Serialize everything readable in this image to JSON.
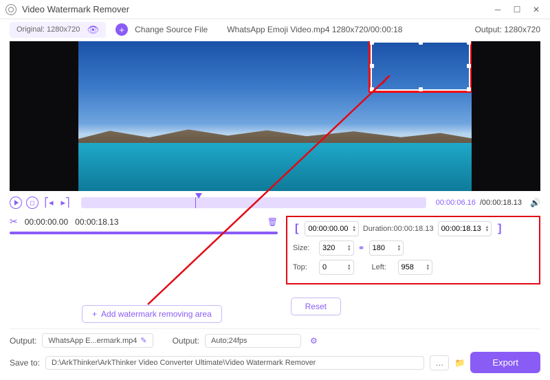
{
  "titlebar": {
    "title": "Video Watermark Remover"
  },
  "top": {
    "original_label": "Original: 1280x720",
    "change_source_label": "Change Source File",
    "file_info": "WhatsApp Emoji Video.mp4    1280x720/00:00:18",
    "output_res": "Output: 1280x720"
  },
  "playback": {
    "current": "00:00:06.16",
    "total": "/00:00:18.13"
  },
  "segment": {
    "start": "00:00:00.00",
    "end": "00:00:18.13"
  },
  "panel": {
    "range_start": "00:00:00.00",
    "duration_label": "Duration:00:00:18.13",
    "range_end": "00:00:18.13",
    "size_label": "Size:",
    "width": "320",
    "height": "180",
    "top_label": "Top:",
    "top": "0",
    "left_label": "Left:",
    "left": "958"
  },
  "buttons": {
    "add_area": "Add watermark removing area",
    "reset": "Reset",
    "export": "Export"
  },
  "output": {
    "label1": "Output:",
    "filename": "WhatsApp E...ermark.mp4",
    "label2": "Output:",
    "format": "Auto;24fps",
    "save_label": "Save to:",
    "save_path": "D:\\ArkThinker\\ArkThinker Video Converter Ultimate\\Video Watermark Remover"
  }
}
